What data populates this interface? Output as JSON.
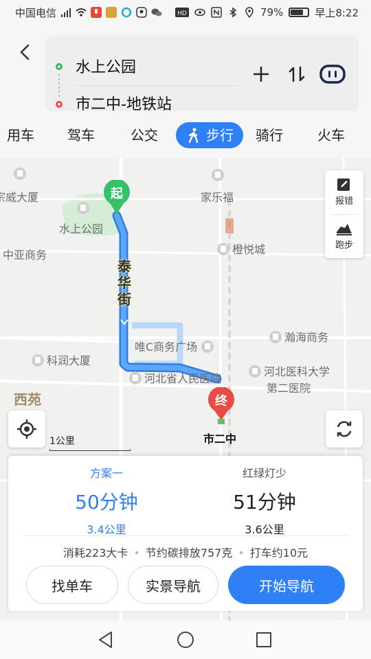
{
  "status_bar": {
    "carrier": "中国电信",
    "network": "4G",
    "battery": "79%",
    "battery_level": 0.79,
    "time": "早上8:22"
  },
  "route": {
    "start": "水上公园",
    "end": "市二中-地铁站"
  },
  "tabs": [
    {
      "label": "用车"
    },
    {
      "label": "驾车"
    },
    {
      "label": "公交"
    },
    {
      "label": "步行",
      "active": true
    },
    {
      "label": "骑行"
    },
    {
      "label": "火车"
    }
  ],
  "map": {
    "pois": {
      "p1": "家乐福",
      "p2": "宗威大厦",
      "p3": "水上公园",
      "p4": "中亚商务",
      "p5": "橙悦城",
      "p6": "唯C商务广场",
      "p7": "瀚海商务",
      "p8": "科润大厦",
      "p9": "河北省人民医院",
      "p10": "河北医科大学",
      "p11": "第二医院"
    },
    "street": "泰华街",
    "district": "西苑",
    "start_marker": "起",
    "end_marker": "终",
    "end_label": "市二中",
    "scale": "1公里",
    "tools": {
      "report": "报错",
      "run": "跑步"
    }
  },
  "plans": [
    {
      "title": "方案一",
      "time": "50分钟",
      "distance": "3.4公里"
    },
    {
      "title": "红绿灯少",
      "time": "51分钟",
      "distance": "3.6公里"
    }
  ],
  "stats": {
    "calories": "消耗223大卡",
    "carbon": "节约碳排放757克",
    "taxi": "打车约10元"
  },
  "buttons": {
    "bike": "找单车",
    "ar_nav": "实景导航",
    "start_nav": "开始导航"
  },
  "colors": {
    "accent": "#2f80f5",
    "start": "#2fbf5f",
    "end": "#e84c45",
    "route": "#4a9bf0"
  }
}
